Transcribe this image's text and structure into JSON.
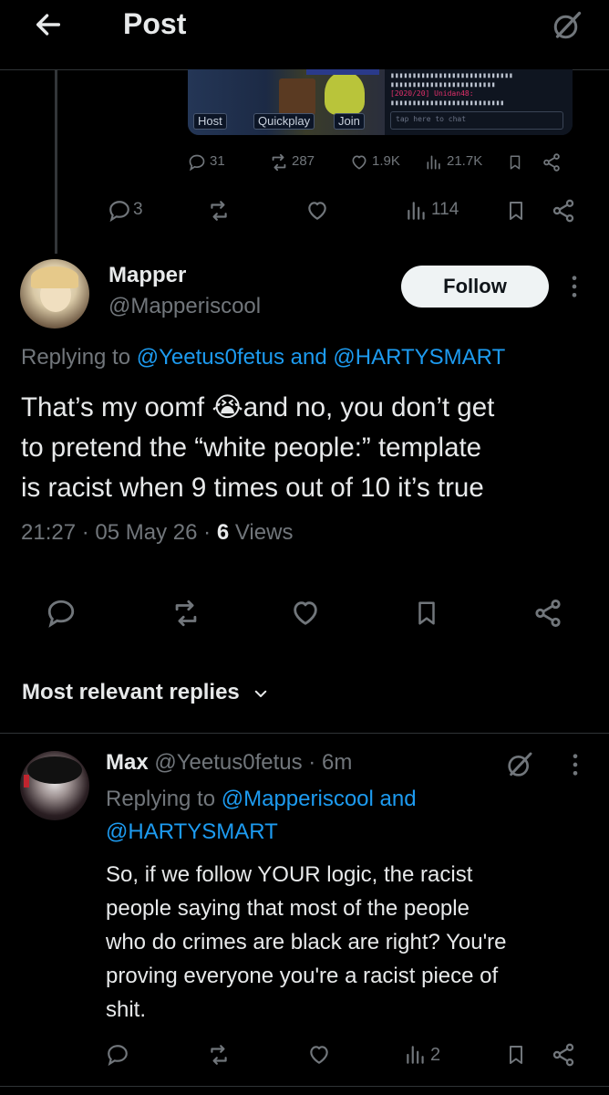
{
  "header": {
    "title": "Post"
  },
  "quoted_media": {
    "buttons": [
      "Host",
      "Quickplay",
      "Join"
    ],
    "chat_lines": [
      "[2020/20] Unidan48:",
      "tap here to chat"
    ]
  },
  "parent_quote_stats": {
    "replies": "31",
    "reposts": "287",
    "likes": "1.9K",
    "views": "21.7K"
  },
  "parent_stats": {
    "replies": "3",
    "views": "114"
  },
  "main_post": {
    "author_name": "Mapper",
    "author_handle": "@Mapperiscool",
    "follow_label": "Follow",
    "replying_prefix": "Replying to",
    "replying_to": "@Yeetus0fetus and @HARTYSMART",
    "text": "That’s my oomf 😭and no, you don’t get\nto pretend the “white people:” template\nis racist when 9 times out of 10 it’s true",
    "time": "21:27",
    "date": "05 May 26",
    "views_count": "6",
    "views_label": "Views"
  },
  "replies_section": {
    "title": "Most relevant replies"
  },
  "reply": {
    "author_name": "Max",
    "author_handle": "@Yeetus0fetus",
    "age": "6m",
    "replying_prefix": "Replying to",
    "replying_to_line1": "@Mapperiscool and",
    "replying_to_line2": "@HARTYSMART",
    "text": "So, if we follow YOUR logic, the racist\npeople saying that most of the people\nwho do crimes are black are right? You're\nproving everyone you're a racist piece of\nshit.",
    "views": "2"
  },
  "colors": {
    "background": "#000000",
    "text": "#e7e9ea",
    "muted": "#71767b",
    "link": "#1d9bf0",
    "follow_bg": "#eff3f4"
  }
}
